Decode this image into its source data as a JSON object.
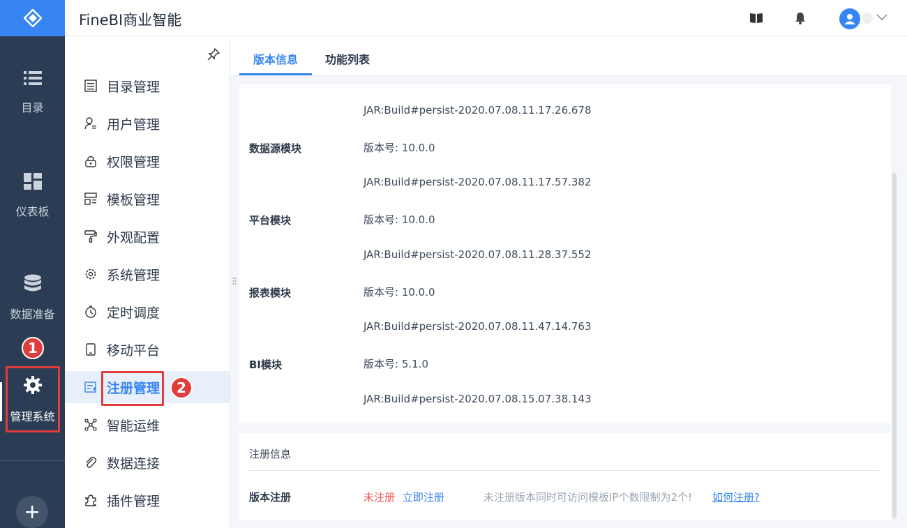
{
  "app": {
    "title": "FineBI商业智能"
  },
  "rail": {
    "items": [
      {
        "label": "目录",
        "icon": "list-icon"
      },
      {
        "label": "仪表板",
        "icon": "dashboard-icon"
      },
      {
        "label": "数据准备",
        "icon": "database-icon"
      },
      {
        "label": "管理系统",
        "icon": "gear-icon"
      }
    ],
    "add_icon": "plus-icon"
  },
  "header": {
    "icons": [
      "book-icon",
      "bell-icon",
      "user-avatar-icon"
    ]
  },
  "submenu": {
    "items": [
      {
        "label": "目录管理",
        "icon": "catalog-icon"
      },
      {
        "label": "用户管理",
        "icon": "user-icon"
      },
      {
        "label": "权限管理",
        "icon": "lock-icon"
      },
      {
        "label": "模板管理",
        "icon": "template-icon"
      },
      {
        "label": "外观配置",
        "icon": "paint-roller-icon"
      },
      {
        "label": "系统管理",
        "icon": "settings-icon"
      },
      {
        "label": "定时调度",
        "icon": "timer-icon"
      },
      {
        "label": "移动平台",
        "icon": "mobile-icon"
      },
      {
        "label": "注册管理",
        "icon": "register-icon",
        "selected": true
      },
      {
        "label": "智能运维",
        "icon": "network-icon"
      },
      {
        "label": "数据连接",
        "icon": "link-icon"
      },
      {
        "label": "插件管理",
        "icon": "plugin-icon"
      }
    ]
  },
  "tabs": [
    {
      "label": "版本信息",
      "active": true
    },
    {
      "label": "功能列表",
      "active": false
    }
  ],
  "version_info": {
    "top_jar": "JAR:Build#persist-2020.07.08.11.17.26.678",
    "modules": [
      {
        "name": "数据源模块",
        "version": "版本号: 10.0.0",
        "jar": "JAR:Build#persist-2020.07.08.11.17.57.382"
      },
      {
        "name": "平台模块",
        "version": "版本号: 10.0.0",
        "jar": "JAR:Build#persist-2020.07.08.11.28.37.552"
      },
      {
        "name": "报表模块",
        "version": "版本号: 10.0.0",
        "jar": "JAR:Build#persist-2020.07.08.11.47.14.763"
      },
      {
        "name": "BI模块",
        "version": "版本号: 5.1.0",
        "jar": "JAR:Build#persist-2020.07.08.15.07.38.143"
      }
    ]
  },
  "registration": {
    "header": "注册信息",
    "label": "版本注册",
    "status": "未注册",
    "register_now": "立即注册",
    "note": "未注册版本同时可访问模板IP个数限制为2个!",
    "how_to": "如何注册?"
  },
  "annotations": {
    "badge1": "1",
    "badge2": "2"
  },
  "colors": {
    "accent": "#3685f2",
    "rail": "#2b3d54",
    "alert": "#e03c3c",
    "unregistered": "#f0504d"
  }
}
